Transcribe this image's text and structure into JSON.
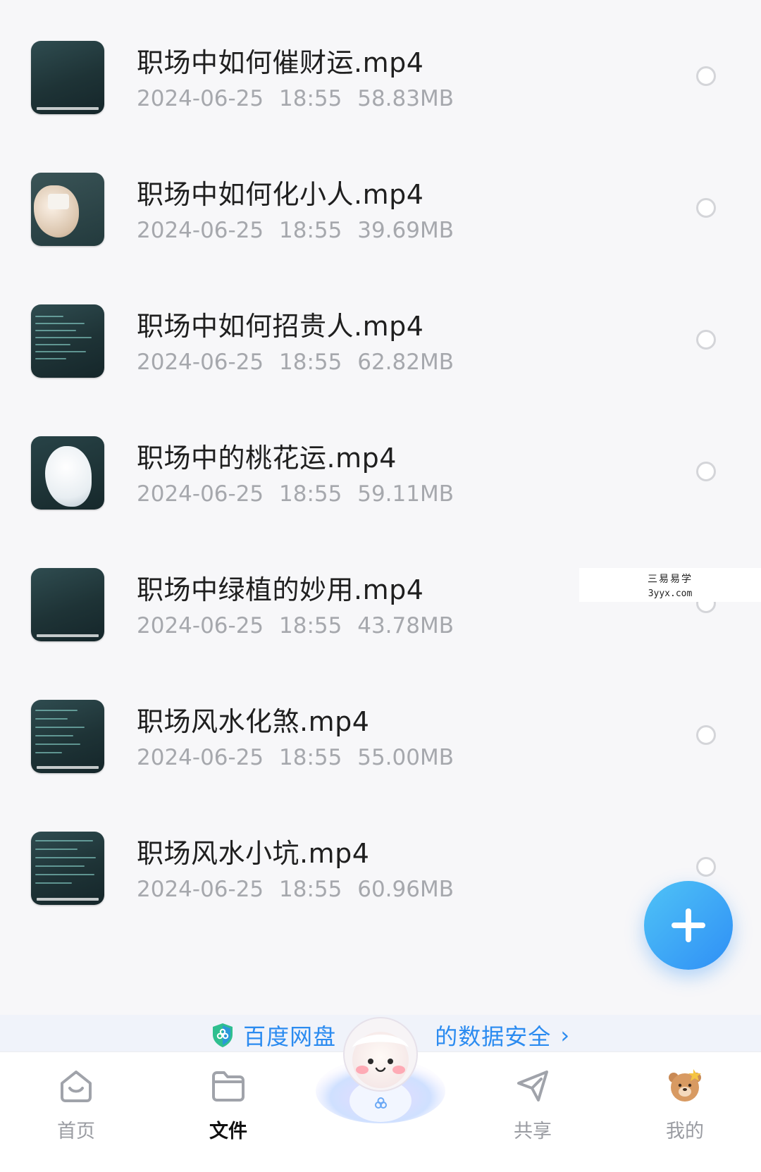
{
  "files": [
    {
      "name": "职场中如何催财运.mp4",
      "date": "2024-06-25",
      "time": "18:55",
      "size": "58.83MB",
      "thumb": "board-caption"
    },
    {
      "name": "职场中如何化小人.mp4",
      "date": "2024-06-25",
      "time": "18:55",
      "size": "39.69MB",
      "thumb": "hand"
    },
    {
      "name": "职场中如何招贵人.mp4",
      "date": "2024-06-25",
      "time": "18:55",
      "size": "62.82MB",
      "thumb": "board-text"
    },
    {
      "name": "职场中的桃花运.mp4",
      "date": "2024-06-25",
      "time": "18:55",
      "size": "59.11MB",
      "thumb": "glove"
    },
    {
      "name": "职场中绿植的妙用.mp4",
      "date": "2024-06-25",
      "time": "18:55",
      "size": "43.78MB",
      "thumb": "board-caption"
    },
    {
      "name": "职场风水化煞.mp4",
      "date": "2024-06-25",
      "time": "18:55",
      "size": "55.00MB",
      "thumb": "board-text"
    },
    {
      "name": "职场风水小坑.mp4",
      "date": "2024-06-25",
      "time": "18:55",
      "size": "60.96MB",
      "thumb": "board-text"
    }
  ],
  "watermark": {
    "line1": "三易易学",
    "line2": "3yyx.com"
  },
  "banner": {
    "part1": "百度网盘",
    "part2": "的数据安全",
    "chevron": "›",
    "icon": "shield-icon"
  },
  "tabs": [
    {
      "label": "首页",
      "icon": "home-icon",
      "active": false
    },
    {
      "label": "文件",
      "icon": "folder-icon",
      "active": true
    },
    {
      "label": "共享",
      "icon": "send-icon",
      "active": false
    },
    {
      "label": "我的",
      "icon": "bear-avatar-icon",
      "active": false
    }
  ],
  "colors": {
    "accent": "#2f8ff5",
    "banner_text": "#2b8bf0",
    "title": "#1f1f1f",
    "meta": "#a6a8ad"
  }
}
